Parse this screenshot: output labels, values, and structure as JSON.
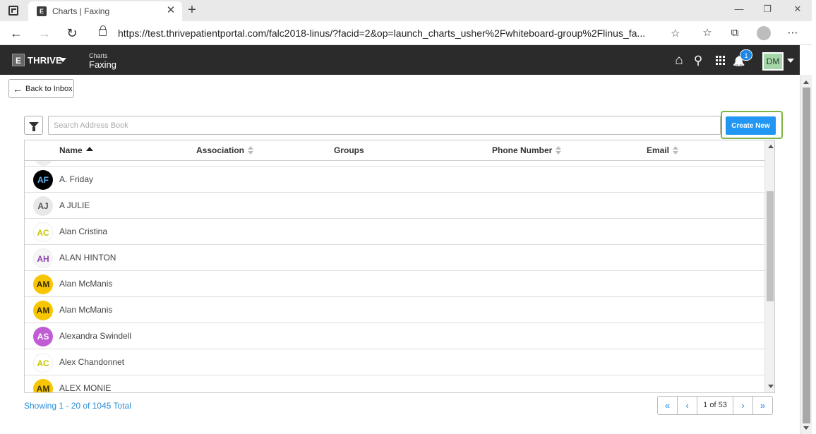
{
  "browser": {
    "tab_title": "Charts | Faxing",
    "tab_close": "✕",
    "new_tab": "+",
    "url": "https://test.thrivepatientportal.com/falc2018-linus/?facid=2&op=launch_charts_usher%2Fwhiteboard-group%2Flinus_fa...",
    "controls": {
      "minimize": "—",
      "restore": "❐",
      "close": "✕"
    },
    "nav": {
      "back": "←",
      "forward": "→",
      "refresh": "↻"
    },
    "icons": {
      "favorites_add": "☆",
      "favorites": "☆",
      "collections": "⧉",
      "menu": "⋯"
    }
  },
  "header": {
    "logo_letter": "E",
    "brand": "THRIVE",
    "crumb_small": "Charts",
    "crumb_main": "Faxing",
    "notification_count": "1",
    "user_initials": "DM",
    "icons": {
      "home": "⌂",
      "search": "⚲",
      "bell": "🔔"
    }
  },
  "toolbar": {
    "back_label": "Back to Inbox",
    "back_arrow": "←",
    "search_placeholder": "Search Address Book",
    "create_label": "Create New"
  },
  "table": {
    "columns": [
      "Name",
      "Association",
      "Groups",
      "Phone Number",
      "Email"
    ],
    "rows": [
      {
        "initials": "AF",
        "name": "A. Friday",
        "bg": "#000000",
        "fg": "#64b5f6"
      },
      {
        "initials": "AJ",
        "name": "A JULIE",
        "bg": "#e8e8e8",
        "fg": "#555555"
      },
      {
        "initials": "AC",
        "name": "Alan Cristina",
        "bg": "#ffffff",
        "fg": "#c6c600"
      },
      {
        "initials": "AH",
        "name": "ALAN HINTON",
        "bg": "#f6f6f6",
        "fg": "#8e44ad"
      },
      {
        "initials": "AM",
        "name": "Alan McManis",
        "bg": "#f7c600",
        "fg": "#3a3000"
      },
      {
        "initials": "AM",
        "name": "Alan McManis",
        "bg": "#f7c600",
        "fg": "#3a3000"
      },
      {
        "initials": "AS",
        "name": "Alexandra Swindell",
        "bg": "#c15dd4",
        "fg": "#ffffff"
      },
      {
        "initials": "AC",
        "name": "Alex Chandonnet",
        "bg": "#ffffff",
        "fg": "#c6c600"
      },
      {
        "initials": "AM",
        "name": "ALEX MONIE",
        "bg": "#f7c600",
        "fg": "#3a3000"
      }
    ]
  },
  "footer": {
    "showing": "Showing 1 - 20 of 1045 Total",
    "page_current": "1",
    "page_of": "of 53",
    "first": "«",
    "prev": "‹",
    "next": "›",
    "last": "»"
  },
  "colors": {
    "accent": "#2196f3",
    "highlight": "#7cb342",
    "header_bg": "#2b2b2b"
  }
}
